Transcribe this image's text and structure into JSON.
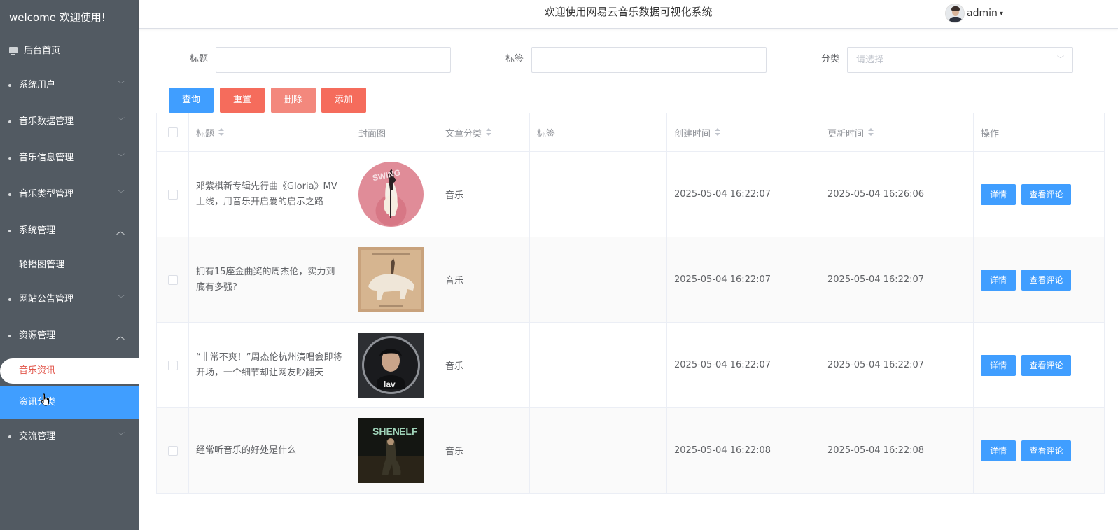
{
  "sidebar": {
    "welcome": "welcome 欢迎使用!",
    "home": "后台首页",
    "menus": [
      {
        "label": "系统用户"
      },
      {
        "label": "音乐数据管理"
      },
      {
        "label": "音乐信息管理"
      },
      {
        "label": "音乐类型管理"
      },
      {
        "label": "系统管理"
      },
      {
        "label": "网站公告管理"
      },
      {
        "label": "资源管理"
      },
      {
        "label": "交流管理"
      }
    ],
    "sub_carousel": "轮播图管理",
    "sub_music_news": "音乐资讯",
    "sub_news_category": "资讯分类"
  },
  "header": {
    "title": "欢迎使用网易云音乐数据可视化系统",
    "user": "admin"
  },
  "search": {
    "title_label": "标题",
    "tag_label": "标签",
    "category_label": "分类",
    "category_placeholder": "请选择"
  },
  "buttons": {
    "query": "查询",
    "reset": "重置",
    "delete": "删除",
    "add": "添加"
  },
  "table": {
    "headers": [
      "标题",
      "封面图",
      "文章分类",
      "标签",
      "创建时间",
      "更新时间",
      "操作"
    ],
    "detail_label": "详情",
    "comments_label": "查看评论",
    "rows": [
      {
        "title": "邓紫棋新专辑先行曲《Gloria》MV上线，用音乐开启爱的启示之路",
        "category": "音乐",
        "tag": "",
        "created": "2025-05-04 16:22:07",
        "updated": "2025-05-04 16:26:06"
      },
      {
        "title": "拥有15座金曲奖的周杰伦，实力到底有多强?",
        "category": "音乐",
        "tag": "",
        "created": "2025-05-04 16:22:07",
        "updated": "2025-05-04 16:22:07"
      },
      {
        "title": "“非常不爽！”周杰伦杭州演唱会即将开场，一个细节却让网友吵翻天",
        "category": "音乐",
        "tag": "",
        "created": "2025-05-04 16:22:07",
        "updated": "2025-05-04 16:22:07"
      },
      {
        "title": "经常听音乐的好处是什么",
        "category": "音乐",
        "tag": "",
        "created": "2025-05-04 16:22:08",
        "updated": "2025-05-04 16:22:08"
      }
    ]
  },
  "colors": {
    "sidebar_bg": "#525a62",
    "primary": "#409eff",
    "danger": "#f56c5c",
    "danger_light": "#f3887d",
    "active_text": "#e2574c"
  }
}
